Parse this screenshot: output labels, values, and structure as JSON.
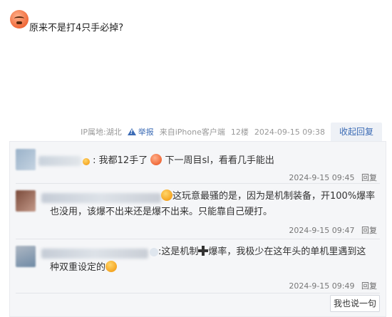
{
  "post": {
    "avatar_icon": "angry-face-emoji",
    "text": "原来不是打4只手必掉?"
  },
  "meta": {
    "ip": "IP属地:湖北",
    "report": "举报",
    "client": "来自iPhone客户端",
    "floor": "12楼",
    "timestamp": "2024-09-15 09:38",
    "collapse": "收起回复"
  },
  "replies": [
    {
      "text_prefix": ": 我都12手了",
      "text_suffix": "下一周目sl，看看几手能出",
      "time": "2024-9-15 09:45",
      "reply_label": "回复"
    },
    {
      "text_prefix": ":",
      "line1": "这玩意最骚的是，因为是机制装备，开100%爆率",
      "line2": "也没用，该爆不出来还是爆不出来。只能靠自己硬打。",
      "time": "2024-9-15 09:47",
      "reply_label": "回复"
    },
    {
      "text_prefix": ":这是机制",
      "text_mid": "爆率，我极少在这年头的单机里遇到这",
      "line2": "种双重设定的",
      "time": "2024-9-15 09:49",
      "reply_label": "回复"
    }
  ],
  "say_button": "我也说一句",
  "colors": {
    "link": "#3b6bb5",
    "panel_bg": "#f5f6f8"
  }
}
